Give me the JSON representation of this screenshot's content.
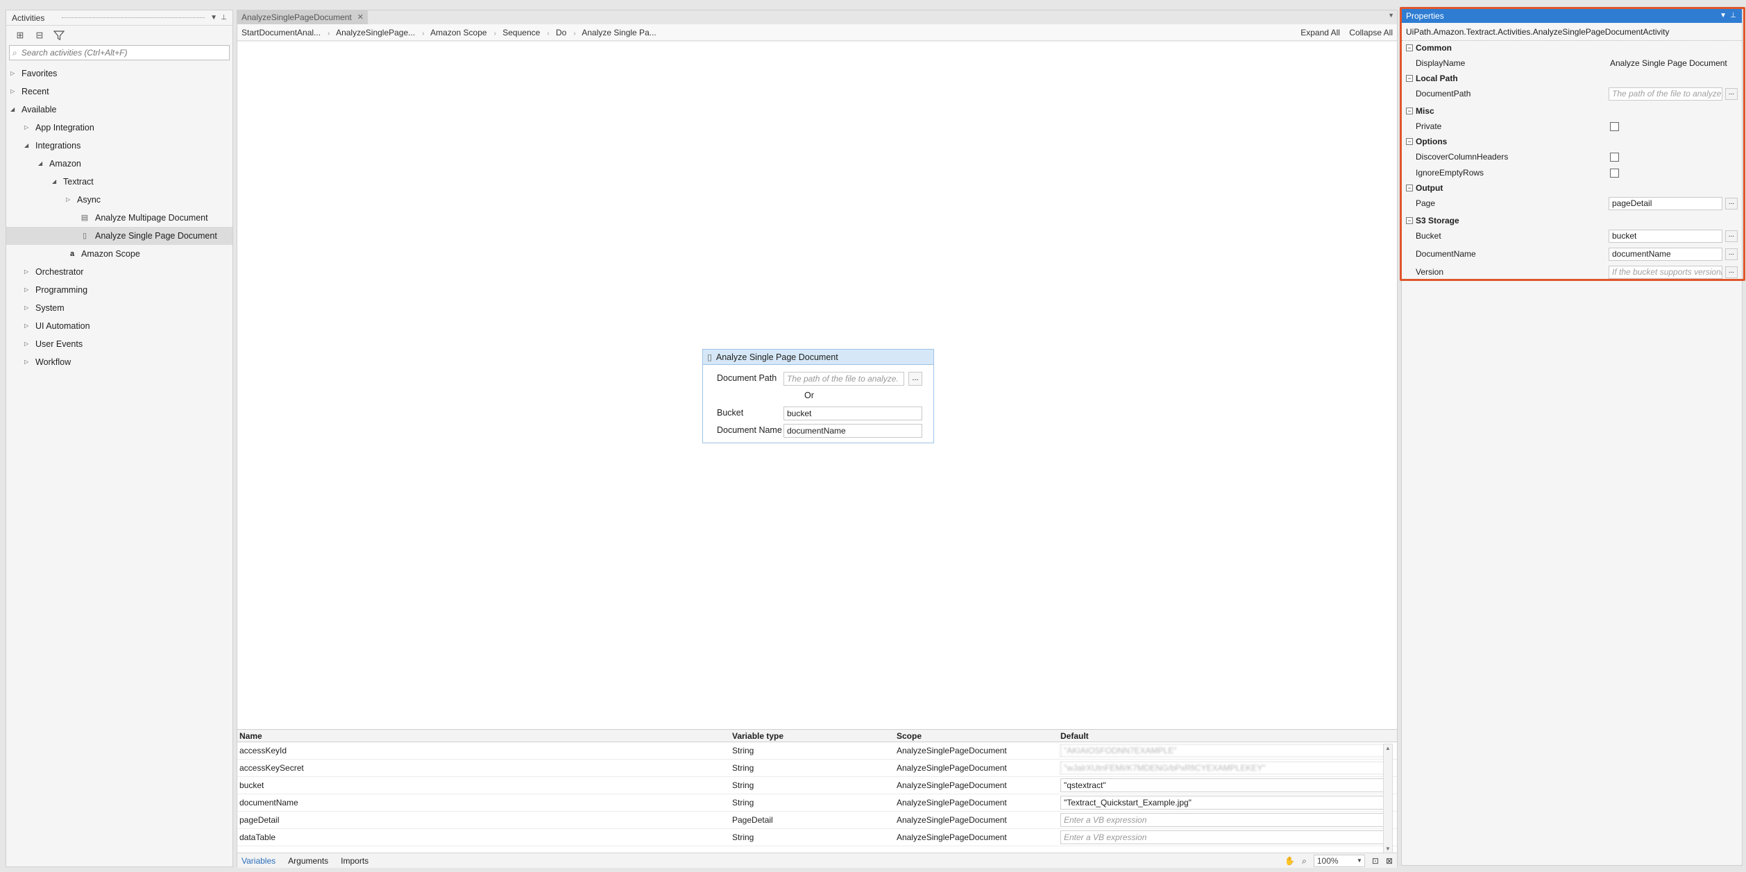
{
  "activities_panel": {
    "title": "Activities",
    "search_placeholder": "Search activities (Ctrl+Alt+F)",
    "tree": [
      {
        "label": "Favorites"
      },
      {
        "label": "Recent"
      },
      {
        "label": "Available"
      },
      {
        "label": "App Integration"
      },
      {
        "label": "Integrations"
      },
      {
        "label": "Amazon"
      },
      {
        "label": "Textract"
      },
      {
        "label": "Async"
      },
      {
        "label": "Analyze Multipage Document"
      },
      {
        "label": "Analyze Single Page Document"
      },
      {
        "label": "Amazon Scope"
      },
      {
        "label": "Orchestrator"
      },
      {
        "label": "Programming"
      },
      {
        "label": "System"
      },
      {
        "label": "UI Automation"
      },
      {
        "label": "User Events"
      },
      {
        "label": "Workflow"
      }
    ]
  },
  "designer": {
    "tab_label": "AnalyzeSinglePageDocument",
    "breadcrumbs": [
      "StartDocumentAnal...",
      "AnalyzeSinglePage...",
      "Amazon Scope",
      "Sequence",
      "Do",
      "Analyze Single Pa..."
    ],
    "expand_all": "Expand All",
    "collapse_all": "Collapse All",
    "activity": {
      "title": "Analyze Single Page Document",
      "document_path_label": "Document Path",
      "document_path_placeholder": "The path of the file to analyze.",
      "or_label": "Or",
      "bucket_label": "Bucket",
      "bucket_value": "bucket",
      "document_name_label": "Document Name",
      "document_name_value": "documentName"
    }
  },
  "variables": {
    "headers": [
      "Name",
      "Variable type",
      "Scope",
      "Default"
    ],
    "rows": [
      {
        "name": "accessKeyId",
        "type": "String",
        "scope": "AnalyzeSinglePageDocument",
        "default": "\"AKIAIOSFODNN7EXAMPLE\""
      },
      {
        "name": "accessKeySecret",
        "type": "String",
        "scope": "AnalyzeSinglePageDocument",
        "default": "\"wJalrXUtnFEMI/K7MDENG/bPxRfiCYEXAMPLEKEY\""
      },
      {
        "name": "bucket",
        "type": "String",
        "scope": "AnalyzeSinglePageDocument",
        "default": "\"qstextract\""
      },
      {
        "name": "documentName",
        "type": "String",
        "scope": "AnalyzeSinglePageDocument",
        "default": "\"Textract_Quickstart_Example.jpg\""
      },
      {
        "name": "pageDetail",
        "type": "PageDetail",
        "scope": "AnalyzeSinglePageDocument",
        "default": "Enter a VB expression"
      },
      {
        "name": "dataTable",
        "type": "String",
        "scope": "AnalyzeSinglePageDocument",
        "default": "Enter a VB expression"
      }
    ],
    "bottom_tabs": [
      "Variables",
      "Arguments",
      "Imports"
    ],
    "zoom": "100%"
  },
  "properties": {
    "title": "Properties",
    "type_name": "UiPath.Amazon.Textract.Activities.AnalyzeSinglePageDocumentActivity",
    "categories": {
      "common": "Common",
      "local_path": "Local Path",
      "misc": "Misc",
      "options": "Options",
      "output": "Output",
      "s3_storage": "S3 Storage"
    },
    "props": {
      "display_name_label": "DisplayName",
      "display_name_value": "Analyze Single Page Document",
      "document_path_label": "DocumentPath",
      "document_path_placeholder": "The path of the file to analyze",
      "private_label": "Private",
      "discover_label": "DiscoverColumnHeaders",
      "ignore_label": "IgnoreEmptyRows",
      "page_label": "Page",
      "page_value": "pageDetail",
      "bucket_label": "Bucket",
      "bucket_value": "bucket",
      "doc_name_label": "DocumentName",
      "doc_name_value": "documentName",
      "version_label": "Version",
      "version_placeholder": "If the bucket supports versioning"
    },
    "highlight_color": "#e0562c",
    "accent_color": "#2f7dd3"
  }
}
